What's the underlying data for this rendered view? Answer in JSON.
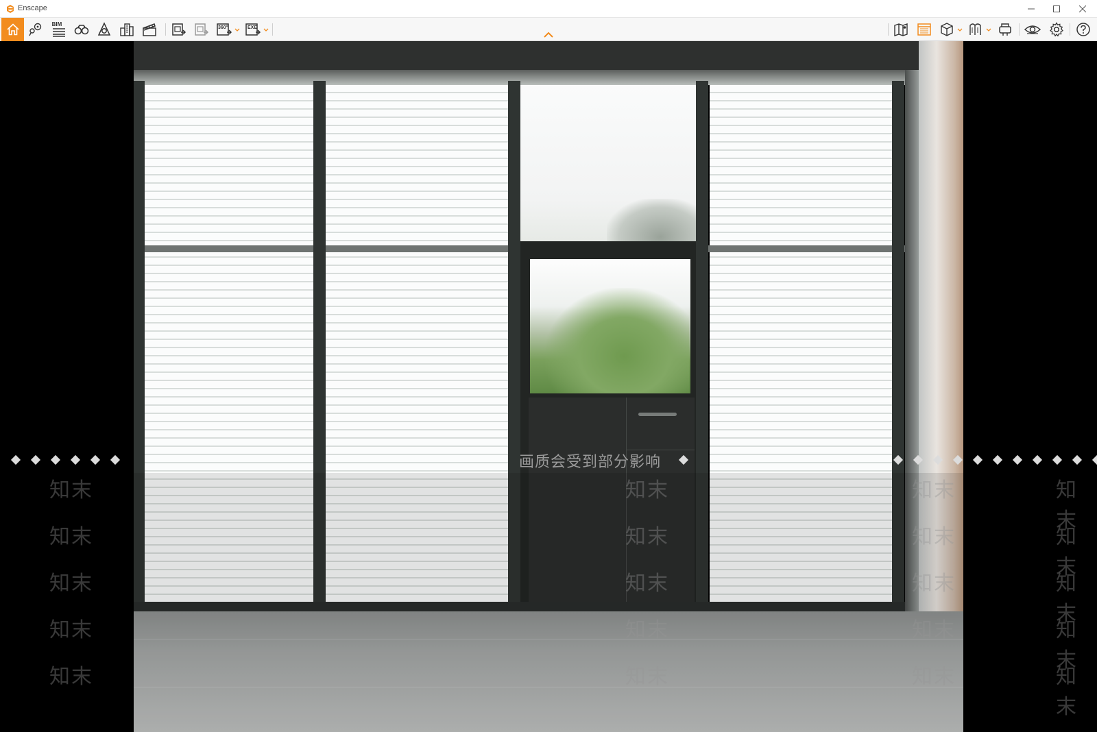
{
  "window": {
    "title": "Enscape"
  },
  "toolbar": {
    "bim_label": "BIM",
    "panorama_label": "360°",
    "exe_label": "EXE"
  },
  "viewport": {
    "scene": "Interior view of a glass facade with a single black door and a concrete floor"
  },
  "watermark": {
    "notice": "画质会受到部分影响",
    "brand": "知末"
  },
  "colors": {
    "accent": "#f28c1e",
    "toolbar_bg": "#f7f7f7",
    "icon": "#333333"
  }
}
